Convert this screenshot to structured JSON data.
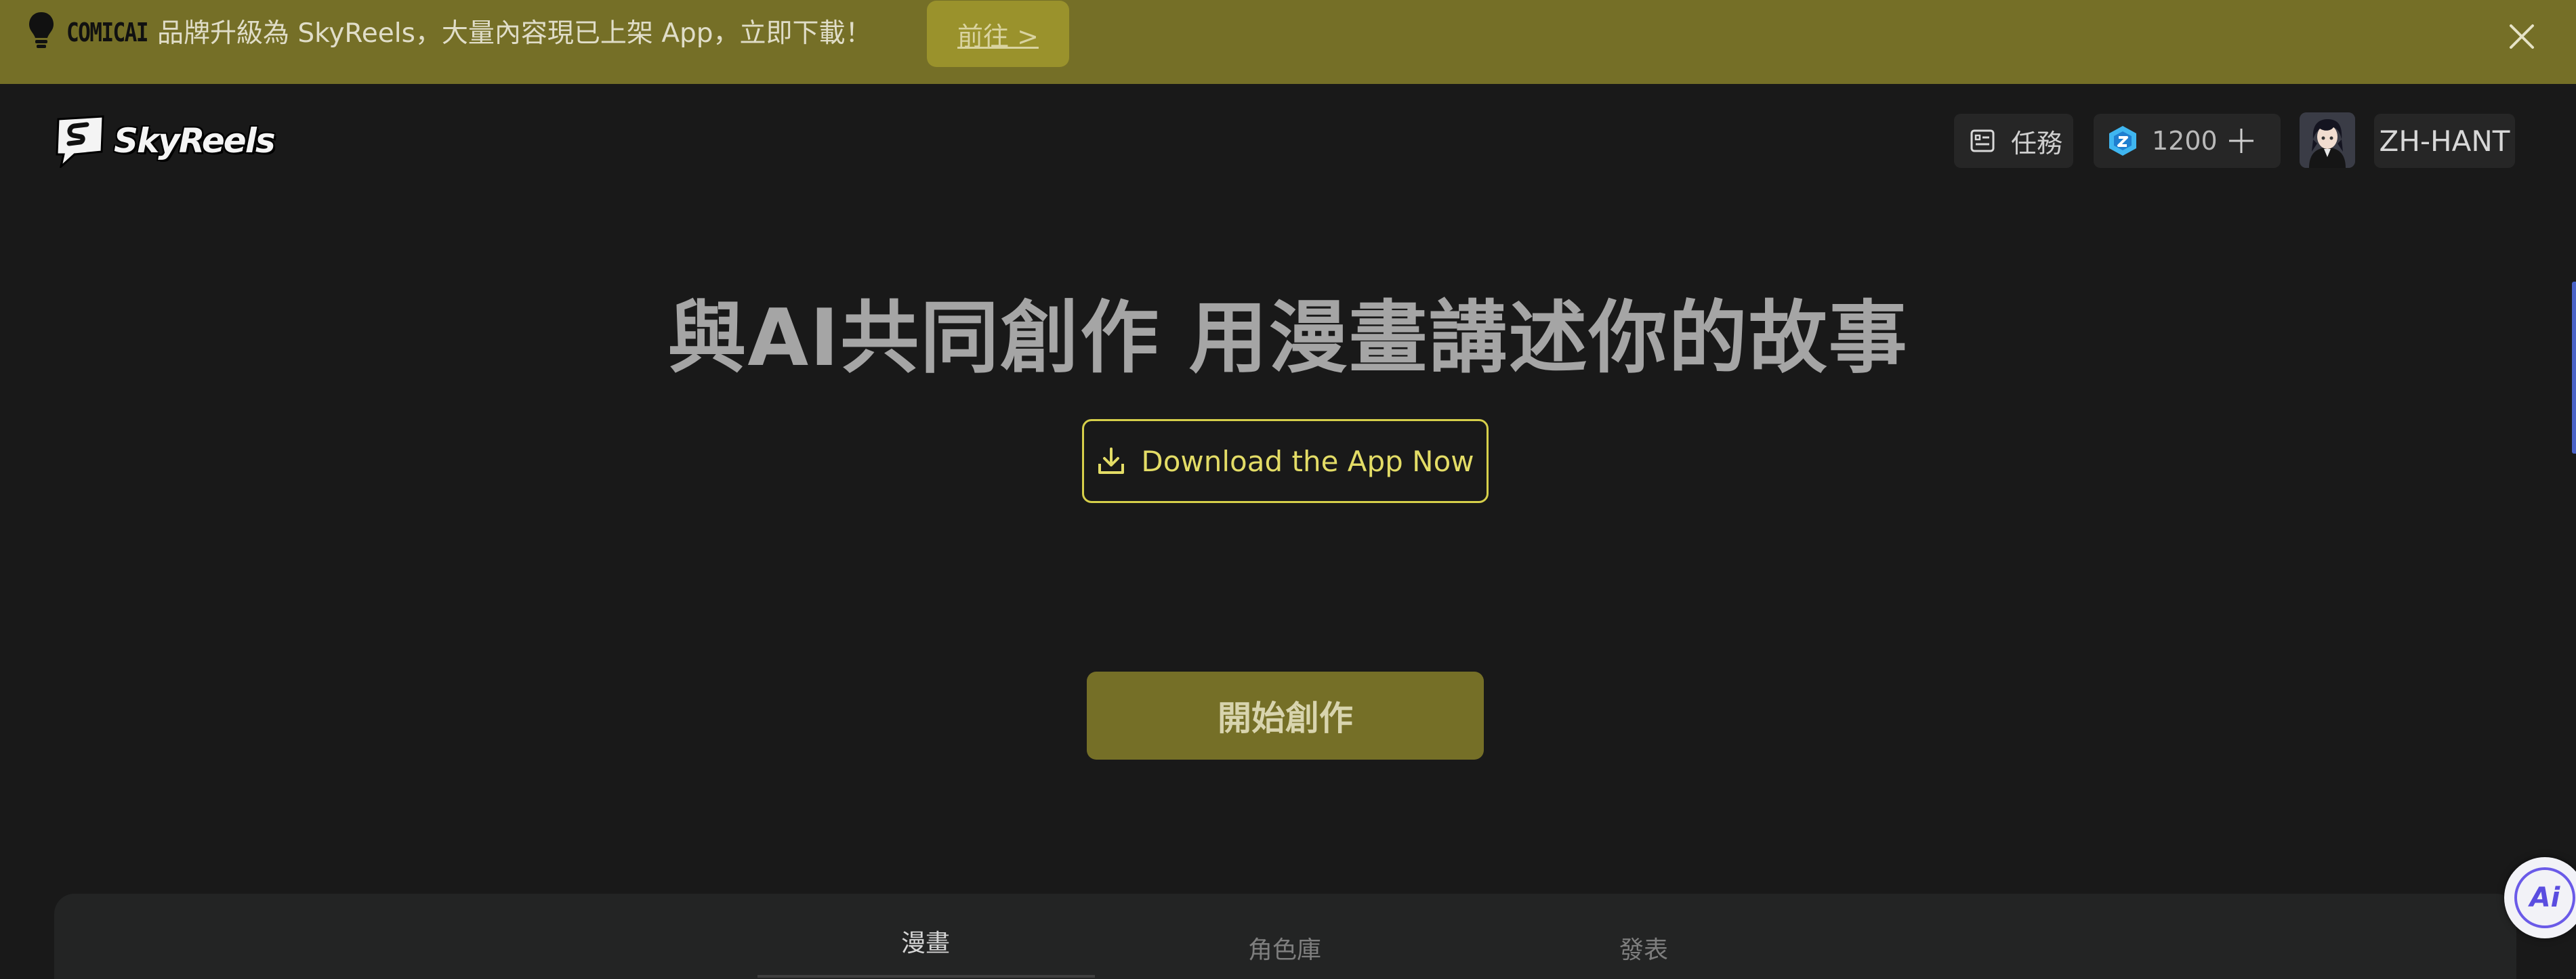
{
  "banner": {
    "brand": "COMICAI",
    "message": "品牌升級為 SkyReels，大量內容現已上架 App，立即下載！",
    "go_label": "前往 >"
  },
  "header": {
    "logo_text": "SkyReels",
    "tasks_label": "任務",
    "credits": "1200",
    "language": "ZH-HANT"
  },
  "hero": {
    "title": "與AI共同創作 用漫畫講述你的故事",
    "download_label": "Download the App Now",
    "start_label": "開始創作"
  },
  "tabs": [
    {
      "label": "漫畫",
      "active": true
    },
    {
      "label": "角色庫",
      "active": false
    },
    {
      "label": "發表",
      "active": false
    }
  ],
  "ai_fab_label": "Ai",
  "colors": {
    "banner_bg": "#756f27",
    "accent_yellow": "#d6cf4a",
    "page_bg": "#191919",
    "credits_gem": "#3fb6f0"
  }
}
